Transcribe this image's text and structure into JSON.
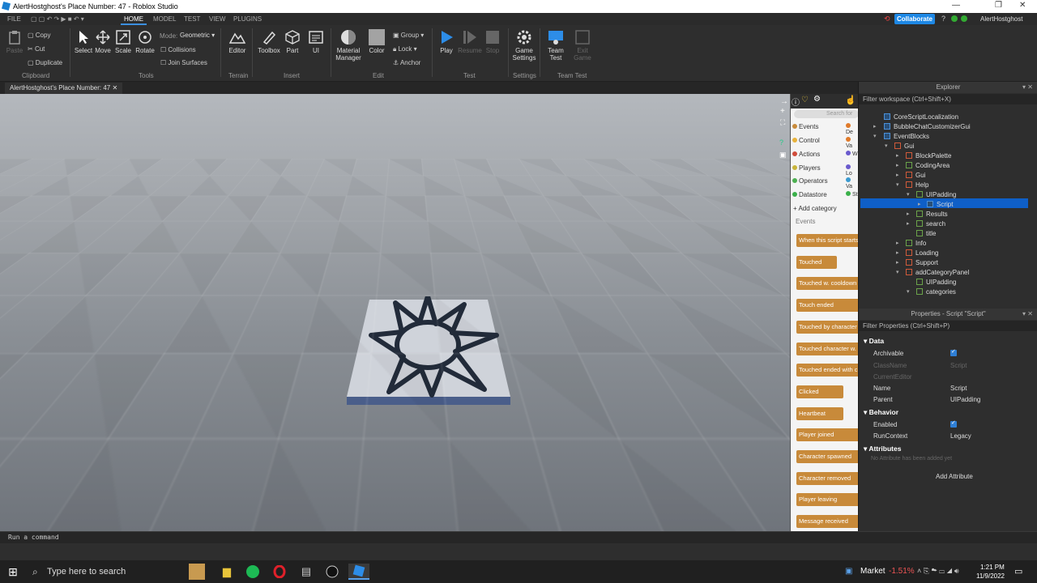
{
  "window": {
    "title": "AlertHostghost's Place Number: 47 - Roblox Studio",
    "user": "AlertHostghost",
    "collaborate": "Collaborate"
  },
  "menu": {
    "file": "FILE",
    "tabs": [
      "HOME",
      "MODEL",
      "TEST",
      "VIEW",
      "PLUGINS"
    ]
  },
  "ribbon": {
    "clipboard": {
      "paste": "Paste",
      "copy": "Copy",
      "cut": "Cut",
      "duplicate": "Duplicate",
      "group": "Clipboard"
    },
    "tools": {
      "select": "Select",
      "move": "Move",
      "scale": "Scale",
      "rotate": "Rotate",
      "mode_label": "Mode:",
      "mode_value": "Geometric",
      "collisions": "Collisions",
      "join_surfaces": "Join Surfaces",
      "group": "Tools"
    },
    "terrain": {
      "editor": "Editor",
      "group": "Terrain"
    },
    "insert": {
      "toolbox": "Toolbox",
      "part": "Part",
      "ui": "UI",
      "group": "Insert"
    },
    "edit": {
      "material_manager": "Material Manager",
      "color": "Color",
      "group_btn": "Group",
      "lock": "Lock",
      "anchor": "Anchor",
      "group": "Edit"
    },
    "test": {
      "play": "Play",
      "resume": "Resume",
      "stop": "Stop",
      "group": "Test"
    },
    "settings": {
      "game_settings": "Game Settings",
      "group": "Settings"
    },
    "team_test": {
      "team_test": "Team Test",
      "exit_game": "Exit Game",
      "group": "Team Test"
    }
  },
  "doc_tab": "AlertHostghost's Place Number: 47",
  "block_panel": {
    "search": "Search for",
    "categories": [
      {
        "label": "Events",
        "color": "#c88a3a"
      },
      {
        "label": "Control",
        "color": "#e8b23a"
      },
      {
        "label": "Actions",
        "color": "#d04b3a"
      },
      {
        "label": "Players",
        "color": "#c8b43a"
      },
      {
        "label": "Operators",
        "color": "#4caf50"
      },
      {
        "label": "Datastore",
        "color": "#3ab04a"
      }
    ],
    "right_col": [
      "De",
      "Va",
      "W",
      "Lo",
      "Va",
      "St"
    ],
    "add_category": "Add category",
    "section": "Events",
    "blocks": [
      "When this script starts",
      "Touched",
      "Touched w. cooldown",
      "Touch ended",
      "Touched by character",
      "Touched character w.",
      "Touched ended with c",
      "Clicked",
      "Heartbeat",
      "Player joined",
      "Character spawned",
      "Character removed",
      "Player leaving",
      "Message received"
    ]
  },
  "explorer": {
    "title": "Explorer",
    "filter": "Filter workspace (Ctrl+Shift+X)",
    "items": [
      "CoreScriptLocalization",
      "BubbleChatCustomizerGui",
      "EventBlocks",
      "Gui",
      "BlockPalette",
      "CodingArea",
      "Gui",
      "Help",
      "UIPadding",
      "Script",
      "Results",
      "search",
      "title",
      "Info",
      "Loading",
      "Support",
      "addCategoryPanel",
      "UIPadding",
      "categories"
    ]
  },
  "properties": {
    "title": "Properties - Script \"Script\"",
    "filter": "Filter Properties (Ctrl+Shift+P)",
    "data_section": "Data",
    "archivable": "Archivable",
    "classname": "ClassName",
    "classname_val": "Script",
    "current_editor": "CurrentEditor",
    "name": "Name",
    "name_val": "Script",
    "parent": "Parent",
    "parent_val": "UIPadding",
    "behavior_section": "Behavior",
    "enabled": "Enabled",
    "run_context": "RunContext",
    "run_context_val": "Legacy",
    "attributes_section": "Attributes",
    "no_attr": "No Attribute has been added yet",
    "add_attribute": "Add Attribute"
  },
  "command_bar": "Run a command",
  "taskbar": {
    "search": "Type here to search",
    "market": "Market",
    "market_change": "-1.51%",
    "time": "1:21 PM",
    "date": "11/9/2022"
  }
}
